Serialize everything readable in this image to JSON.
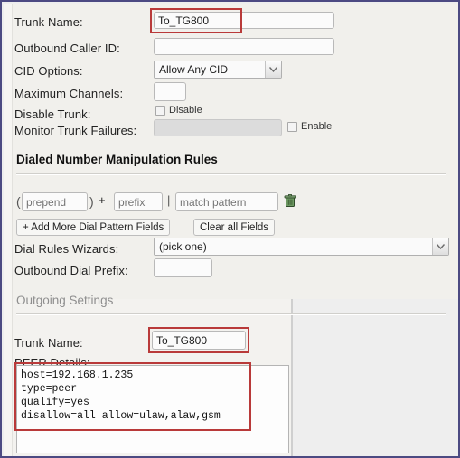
{
  "window": {
    "border_color": "#4c4a82",
    "background": "#eeeeee",
    "panel_background": "#f1f0ec",
    "annotation_color": "#b93a3a"
  },
  "general_settings": {
    "rows": [
      {
        "label": "Trunk Name:",
        "value": "To_TG800",
        "placeholder": "",
        "kind": "text"
      },
      {
        "label": "Outbound Caller ID:",
        "value": "",
        "placeholder": "",
        "kind": "text"
      },
      {
        "label": "CID Options:",
        "value": "Allow Any CID",
        "kind": "select"
      },
      {
        "label": "Maximum Channels:",
        "value": "",
        "placeholder": "",
        "kind": "text"
      },
      {
        "label": "Disable Trunk:",
        "checkbox_label": "Disable",
        "checked": false,
        "kind": "checkbox"
      },
      {
        "label": "Monitor Trunk Failures:",
        "value": "",
        "disabled": true,
        "checkbox_label": "Enable",
        "checked": false,
        "kind": "text-checkbox"
      }
    ]
  },
  "dial_rules": {
    "heading": "Dialed Number Manipulation Rules",
    "pattern_row": {
      "open_paren": "(",
      "prepend_placeholder": "prepend",
      "prepend_value": "",
      "close_paren": ")",
      "plus": "+",
      "prefix_placeholder": "prefix",
      "prefix_value": "",
      "pipe": "|",
      "match_placeholder": "match pattern",
      "match_value": "",
      "delete_icon": "trash-icon"
    },
    "add_button": "+ Add More Dial Pattern Fields",
    "clear_button": "Clear all Fields",
    "wizards_label": "Dial Rules Wizards:",
    "wizards_value": "(pick one)",
    "outbound_prefix_label": "Outbound Dial Prefix:",
    "outbound_prefix_value": ""
  },
  "outgoing": {
    "heading": "Outgoing Settings",
    "trunk_name_label": "Trunk Name:",
    "trunk_name_value": "To_TG800",
    "peer_details_label": "PEER Details:",
    "peer_details_value": "host=192.168.1.235\ntype=peer\nqualify=yes\ndisallow=all allow=ulaw,alaw,gsm"
  }
}
